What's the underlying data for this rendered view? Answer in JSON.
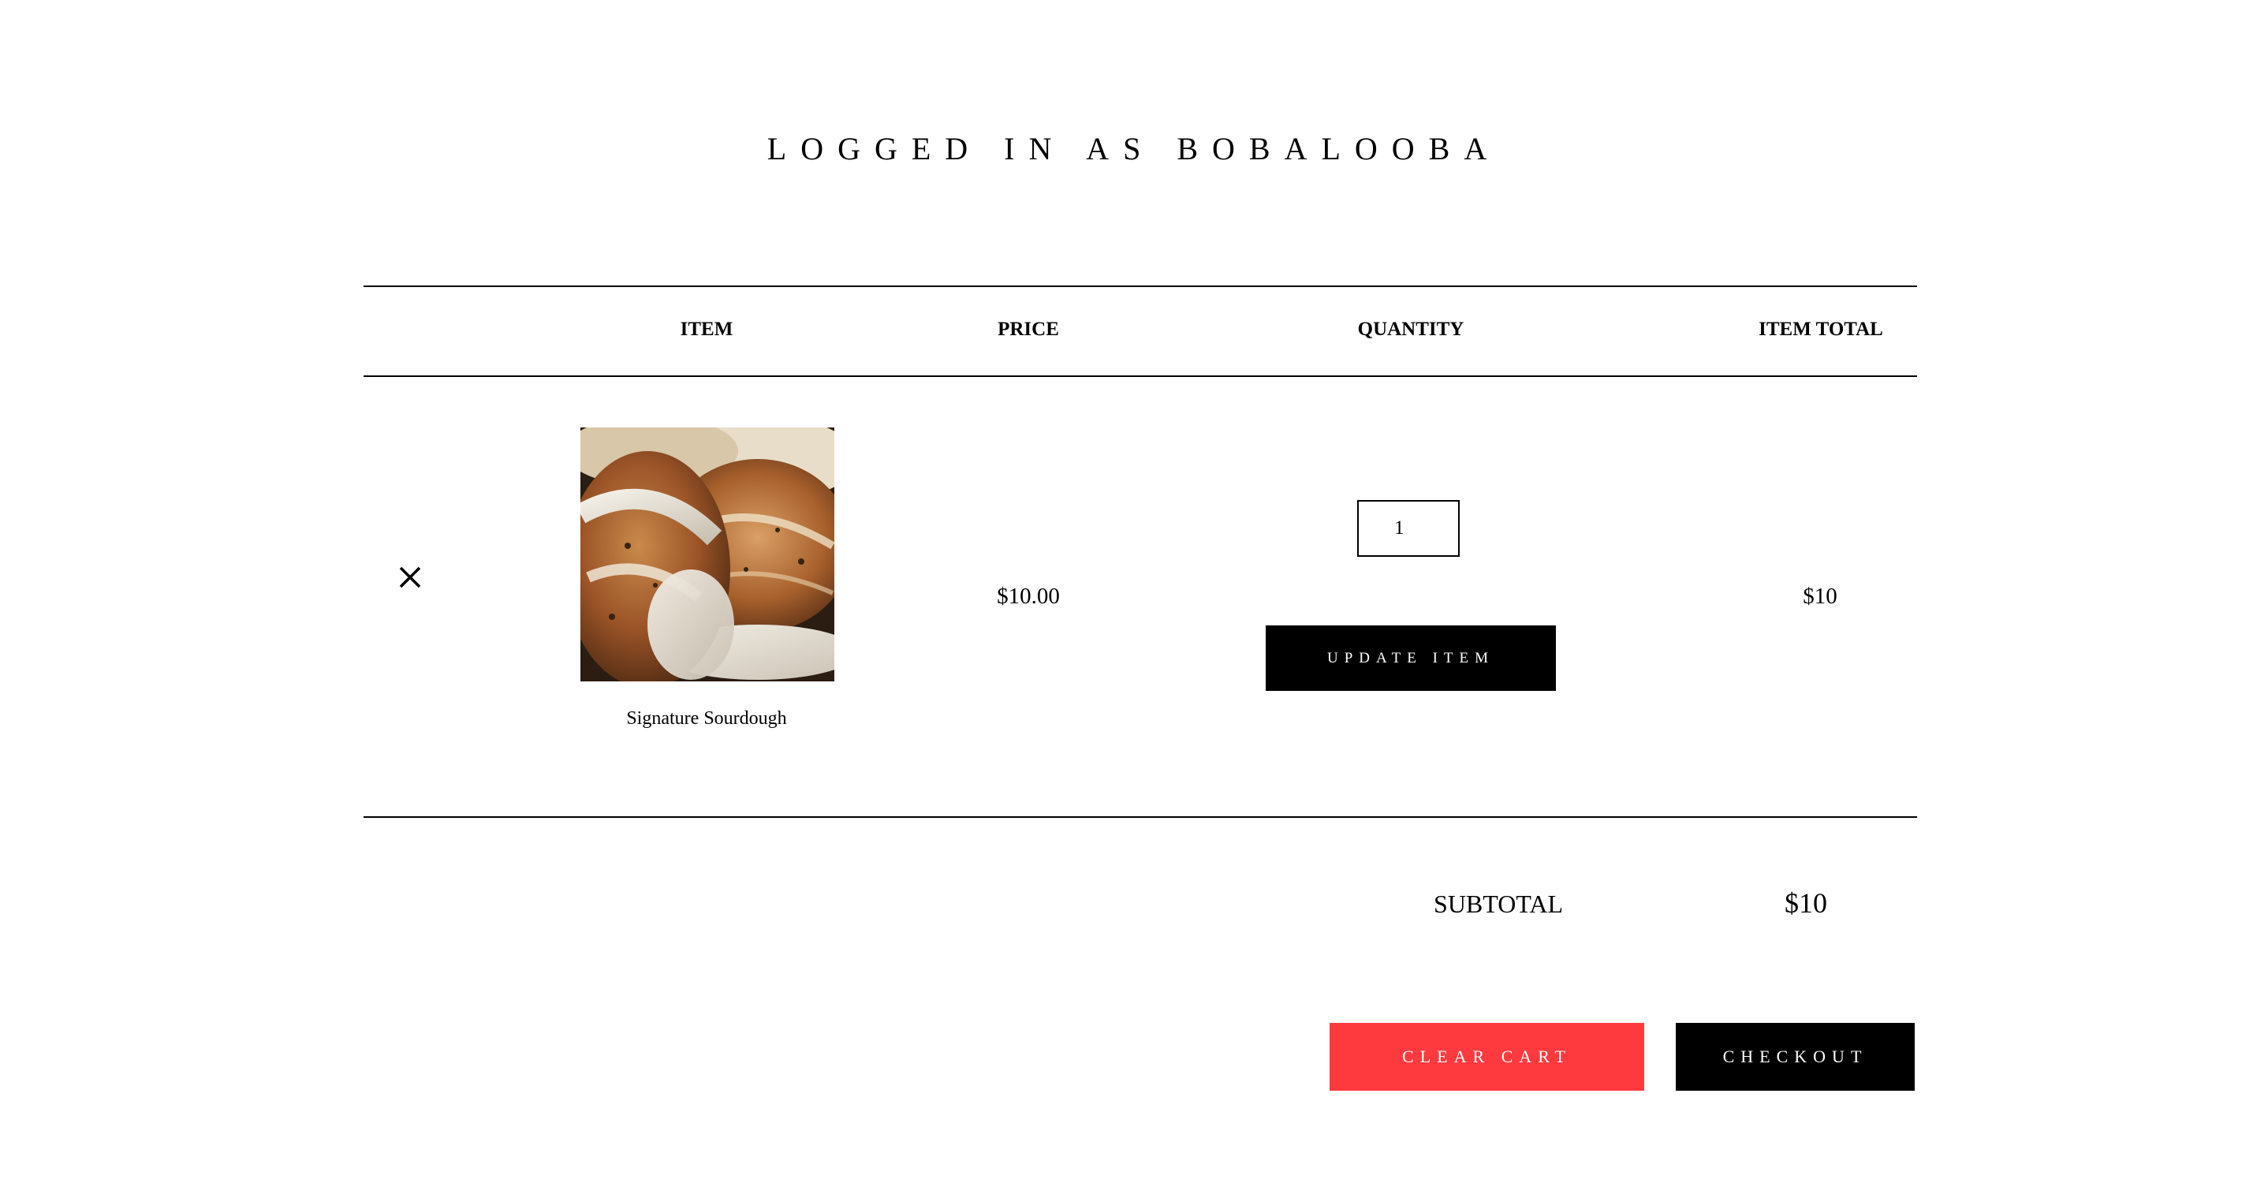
{
  "header": {
    "title": "LOGGED IN AS BOBALOOBA"
  },
  "table": {
    "columns": [
      "ITEM",
      "PRICE",
      "QUANTITY",
      "ITEM TOTAL"
    ],
    "rows": [
      {
        "remove_icon": "close-icon",
        "image_icon": "sourdough-bread-image",
        "name": "Signature Sourdough",
        "price": "$10.00",
        "quantity": "1",
        "update_label": "UPDATE ITEM",
        "item_total": "$10"
      }
    ]
  },
  "summary": {
    "subtotal_label": "SUBTOTAL",
    "subtotal_value": "$10"
  },
  "actions": {
    "clear_label": "CLEAR CART",
    "checkout_label": "CHECKOUT"
  },
  "colors": {
    "text": "#000000",
    "background": "#ffffff",
    "primary_button": "#000000",
    "danger_button": "#ff3a3f"
  }
}
